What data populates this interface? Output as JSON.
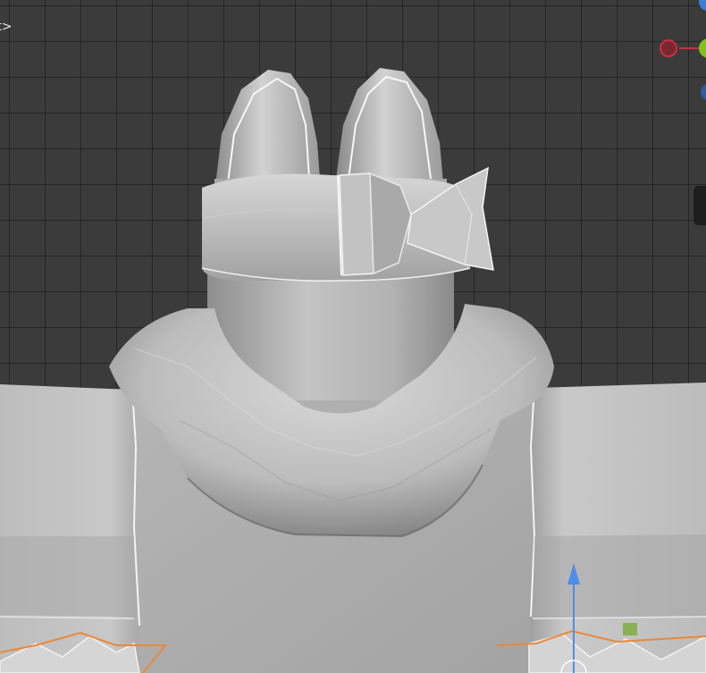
{
  "viewport": {
    "breadcrumb_text": "art>",
    "background_color": "#3b3b3b"
  },
  "navigation_gizmo": {
    "x_axis_color": "#c8313e",
    "y_axis_color": "#7fc21f",
    "z_axis_color": "#3b7ed6"
  },
  "transform_gizmo": {
    "arrow_color": "#4f8de8",
    "plane_handle_color": "#7fae3f"
  },
  "selection": {
    "outline_color": "#e8893a"
  },
  "model": {
    "body_color": "#b9b9b9",
    "highlight_color": "#f2f2f2",
    "shadow_color": "#6f6f6f"
  }
}
